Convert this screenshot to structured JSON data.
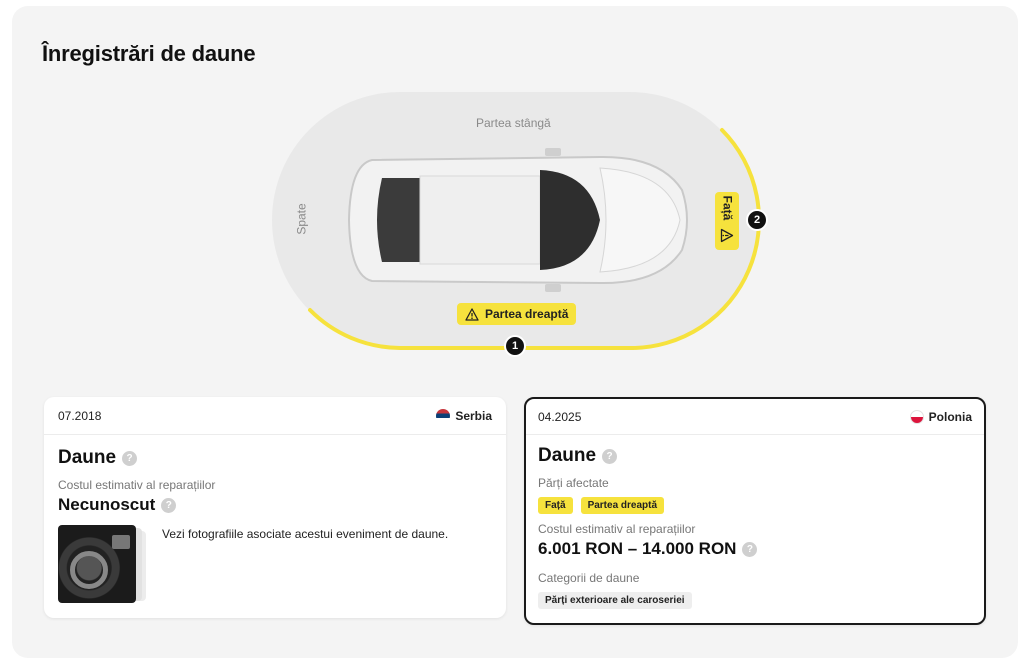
{
  "page": {
    "title": "Înregistrări de daune"
  },
  "diagram": {
    "labels": {
      "left": "Partea stângă",
      "rear": "Spate"
    },
    "tags": {
      "right": "Partea dreaptă",
      "front": "Față"
    },
    "markers": {
      "m1": "1",
      "m2": "2"
    },
    "accent_color": "#f6e23d"
  },
  "cards": [
    {
      "date": "07.2018",
      "country": "Serbia",
      "title": "Daune",
      "help": "?",
      "cost_label": "Costul estimativ al reparațiilor",
      "cost_value": "Necunoscut",
      "photos_text": "Vezi fotografiile asociate acestui eveniment de daune."
    },
    {
      "date": "04.2025",
      "country": "Polonia",
      "title": "Daune",
      "help": "?",
      "parts_label": "Părți afectate",
      "parts": [
        "Față",
        "Partea dreaptă"
      ],
      "cost_label": "Costul estimativ al reparațiilor",
      "cost_value": "6.001 RON – 14.000 RON",
      "categories_label": "Categorii de daune",
      "categories": [
        "Părți exterioare ale caroseriei"
      ]
    }
  ]
}
